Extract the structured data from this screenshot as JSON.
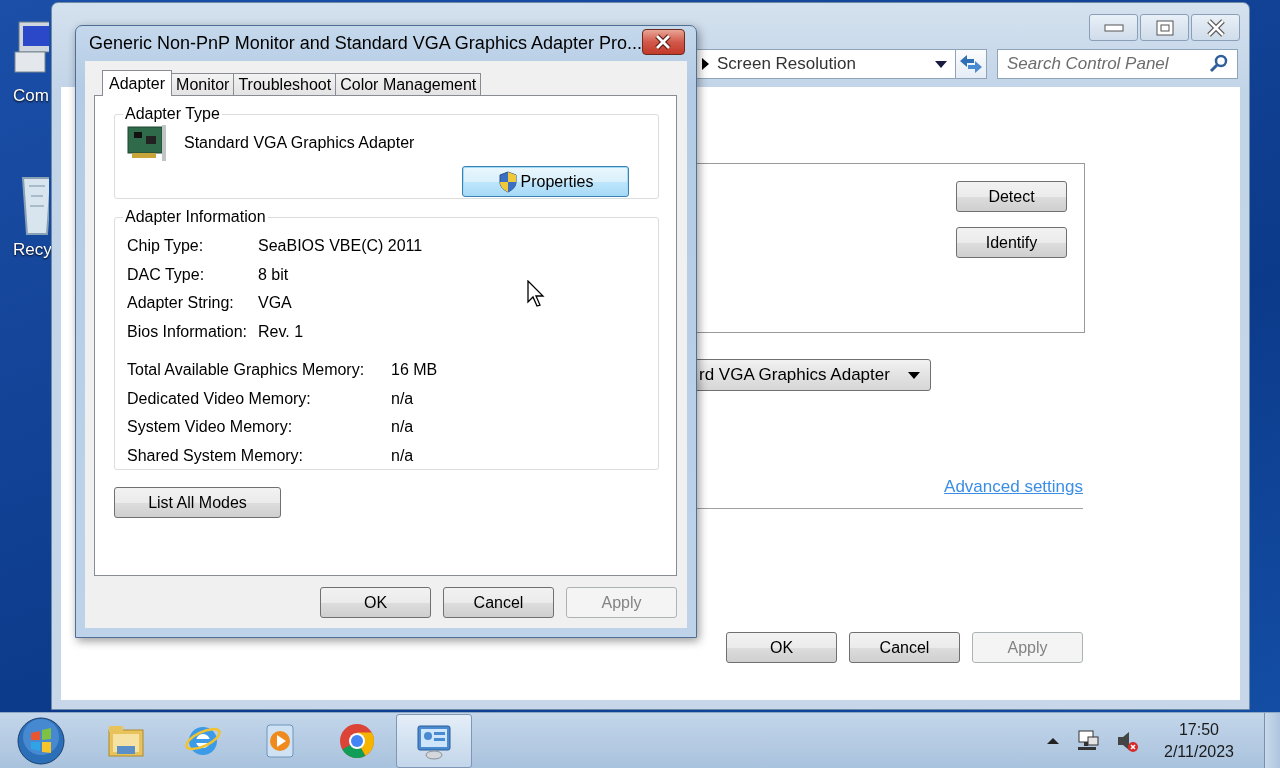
{
  "desktop_icons": [
    {
      "kind": "computer",
      "label": "Com"
    },
    {
      "kind": "recycle-bin",
      "label": "Recy"
    }
  ],
  "main_window": {
    "breadcrumb": "Screen Resolution",
    "search": {
      "placeholder": "Search Control Panel"
    },
    "side_buttons": [
      {
        "label": "Detect"
      },
      {
        "label": "Identify"
      }
    ],
    "display_dropdown": {
      "value": "rd VGA Graphics Adapter"
    },
    "advanced_link": "Advanced settings",
    "buttons": [
      {
        "label": "OK",
        "disabled": false
      },
      {
        "label": "Cancel",
        "disabled": false
      },
      {
        "label": "Apply",
        "disabled": true
      }
    ]
  },
  "dialog": {
    "title": "Generic Non-PnP Monitor and Standard VGA Graphics Adapter Pro...",
    "tabs": [
      {
        "label": "Adapter",
        "selected": true
      },
      {
        "label": "Monitor",
        "selected": false
      },
      {
        "label": "Troubleshoot",
        "selected": false
      },
      {
        "label": "Color Management",
        "selected": false
      }
    ],
    "adapter_type": {
      "heading": "Adapter Type",
      "name": "Standard VGA Graphics Adapter",
      "button": {
        "label": "Properties",
        "focused": true
      }
    },
    "adapter_information": {
      "heading": "Adapter Information",
      "rows": [
        {
          "label": "Chip Type:",
          "value": "SeaBIOS VBE(C) 2011"
        },
        {
          "label": "DAC Type:",
          "value": "8 bit"
        },
        {
          "label": "Adapter String:",
          "value": "VGA"
        },
        {
          "label": "Bios Information:",
          "value": "Rev. 1"
        }
      ],
      "memory_rows": [
        {
          "label": "Total Available Graphics Memory:",
          "value": "16 MB"
        },
        {
          "label": "Dedicated Video Memory:",
          "value": "n/a"
        },
        {
          "label": "System Video Memory:",
          "value": "n/a"
        },
        {
          "label": "Shared System Memory:",
          "value": "n/a"
        }
      ]
    },
    "list_modes_button": "List All Modes",
    "buttons": [
      {
        "label": "OK",
        "disabled": false
      },
      {
        "label": "Cancel",
        "disabled": false
      },
      {
        "label": "Apply",
        "disabled": true
      }
    ]
  },
  "taskbar": {
    "apps": [
      {
        "kind": "folder",
        "selected": false
      },
      {
        "kind": "browser-e",
        "selected": false
      },
      {
        "kind": "media",
        "selected": false
      },
      {
        "kind": "chrome",
        "selected": false
      },
      {
        "kind": "display",
        "selected": true
      }
    ],
    "time": "17:50",
    "date": "2/11/2023"
  }
}
